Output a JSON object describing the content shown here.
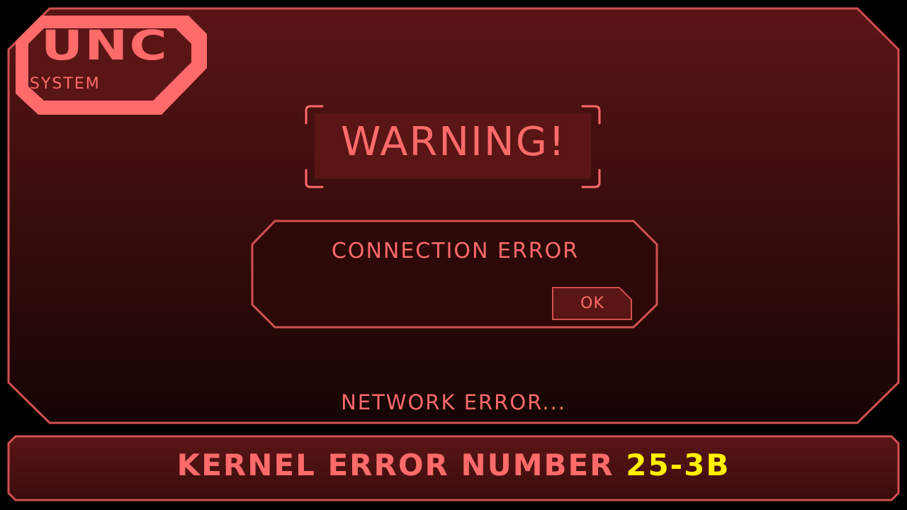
{
  "logo": {
    "main": "UNC",
    "sub": "SYSTEM"
  },
  "warning": {
    "title": "WARNING!"
  },
  "dialog": {
    "message": "CONNECTION ERROR",
    "ok_label": "OK"
  },
  "status": {
    "text": "NETWORK ERROR..."
  },
  "footer": {
    "kernel_label": "KERNEL ERROR NUMBER",
    "kernel_code": "25-3B"
  },
  "colors": {
    "accent": "#ff6a6a",
    "border": "#d25050",
    "panel_top": "#5a1515",
    "panel_bottom": "#1a0505",
    "code_highlight": "#fff000"
  }
}
